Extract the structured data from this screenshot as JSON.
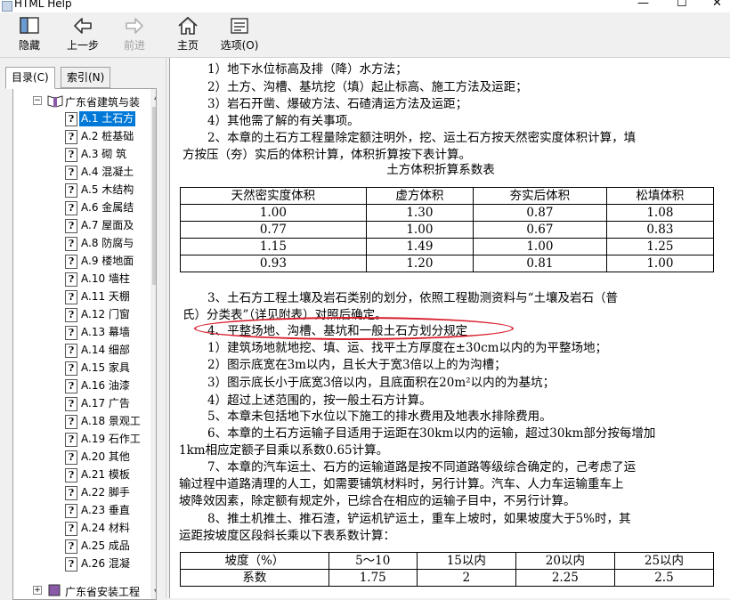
{
  "window": {
    "title": "HTML Help",
    "minimize": "—",
    "maximize": "☐",
    "close": "✕"
  },
  "toolbar": {
    "hide": "隐藏",
    "back": "上一步",
    "forward": "前进",
    "home": "主页",
    "options": "选项(O)"
  },
  "tabs": {
    "contents": "目录(C)",
    "index": "索引(N)"
  },
  "tree": {
    "root": "广东省建筑与装",
    "items": [
      "A.1  土石方",
      "A.2  桩基础",
      "A.3  砌  筑",
      "A.4  混凝土",
      "A.5  木结构",
      "A.6  金属结",
      "A.7  屋面及",
      "A.8  防腐与",
      "A.9  楼地面",
      "A.10  墙柱",
      "A.11  天棚",
      "A.12  门窗",
      "A.13  幕墙",
      "A.14  细部",
      "A.15  家具",
      "A.16  油漆",
      "A.17  广告",
      "A.18 景观工",
      "A.19 石作工",
      "A.20  其他",
      "A.21  模板",
      "A.22  脚手",
      "A.23  垂直",
      "A.24  材料",
      "A.25  成品",
      "A.26  混凝"
    ],
    "bottom": "广东省安装工程"
  },
  "content": {
    "lines_top": [
      "1）地下水位标高及排（降）水方法；",
      "2）土方、沟槽、基坑挖（填）起止标高、施工方法及运距；",
      "3）岩石开凿、爆破方法、石碴清运方法及运距；",
      "4）其他需了解的有关事项。",
      "2、本章的土石方工程量除定额注明外，挖、运土石方按天然密实度体积计算，填",
      "方按压（夯）实后的体积计算，体积折算按下表计算。"
    ],
    "table1_title": "土方体积折算系数表",
    "table1": {
      "headers": [
        "天然密实度体积",
        "虚方体积",
        "夯实后体积",
        "松填体积"
      ],
      "rows": [
        [
          "1.00",
          "1.30",
          "0.87",
          "1.08"
        ],
        [
          "0.77",
          "1.00",
          "0.67",
          "0.83"
        ],
        [
          "1.15",
          "1.49",
          "1.00",
          "1.25"
        ],
        [
          "0.93",
          "1.20",
          "0.81",
          "1.00"
        ]
      ]
    },
    "lines_mid": [
      "3、土石方工程土壤及岩石类别的划分，依照工程勘测资料与“土壤及岩石（普",
      "氏）分类表”（详见附表）对照后确定。",
      "4、平整场地、沟槽、基坑和一般土石方划分规定",
      "1）建筑场地就地挖、填、运、找平土方厚度在±30cm以内的为平整场地；",
      "2）图示底宽在3m以内，且长大于宽3倍以上的为沟槽；",
      "3）图示底长小于底宽3倍以内，且底面积在20m²以内的为基坑；",
      "4）超过上述范围的，按一般土石方计算。",
      "5、本章未包括地下水位以下施工的排水费用及地表水排除费用。",
      "6、本章的土石方运输子目适用于运距在30km以内的运输，超过30km部分按每增加",
      "1km相应定额子目乘以系数0.65计算。",
      "7、本章的汽车运土、石方的运输道路是按不同道路等级综合确定的，己考虑了运",
      "输过程中道路清理的人工，如需要铺筑材料时，另行计算。汽车、人力车运输重车上",
      "坡降效因素，除定额有规定外，已综合在相应的运输子目中，不另行计算。",
      "8、推土机推土、推石渣，铲运机铲运土，重车上坡时，如果坡度大于5%时，其",
      "运距按坡度区段斜长乘以下表系数计算："
    ],
    "table2": {
      "rows": [
        [
          "坡度（%）",
          "5～10",
          "15以内",
          "20以内",
          "25以内"
        ],
        [
          "系数",
          "1.75",
          "2",
          "2.25",
          "2.5"
        ]
      ]
    }
  }
}
